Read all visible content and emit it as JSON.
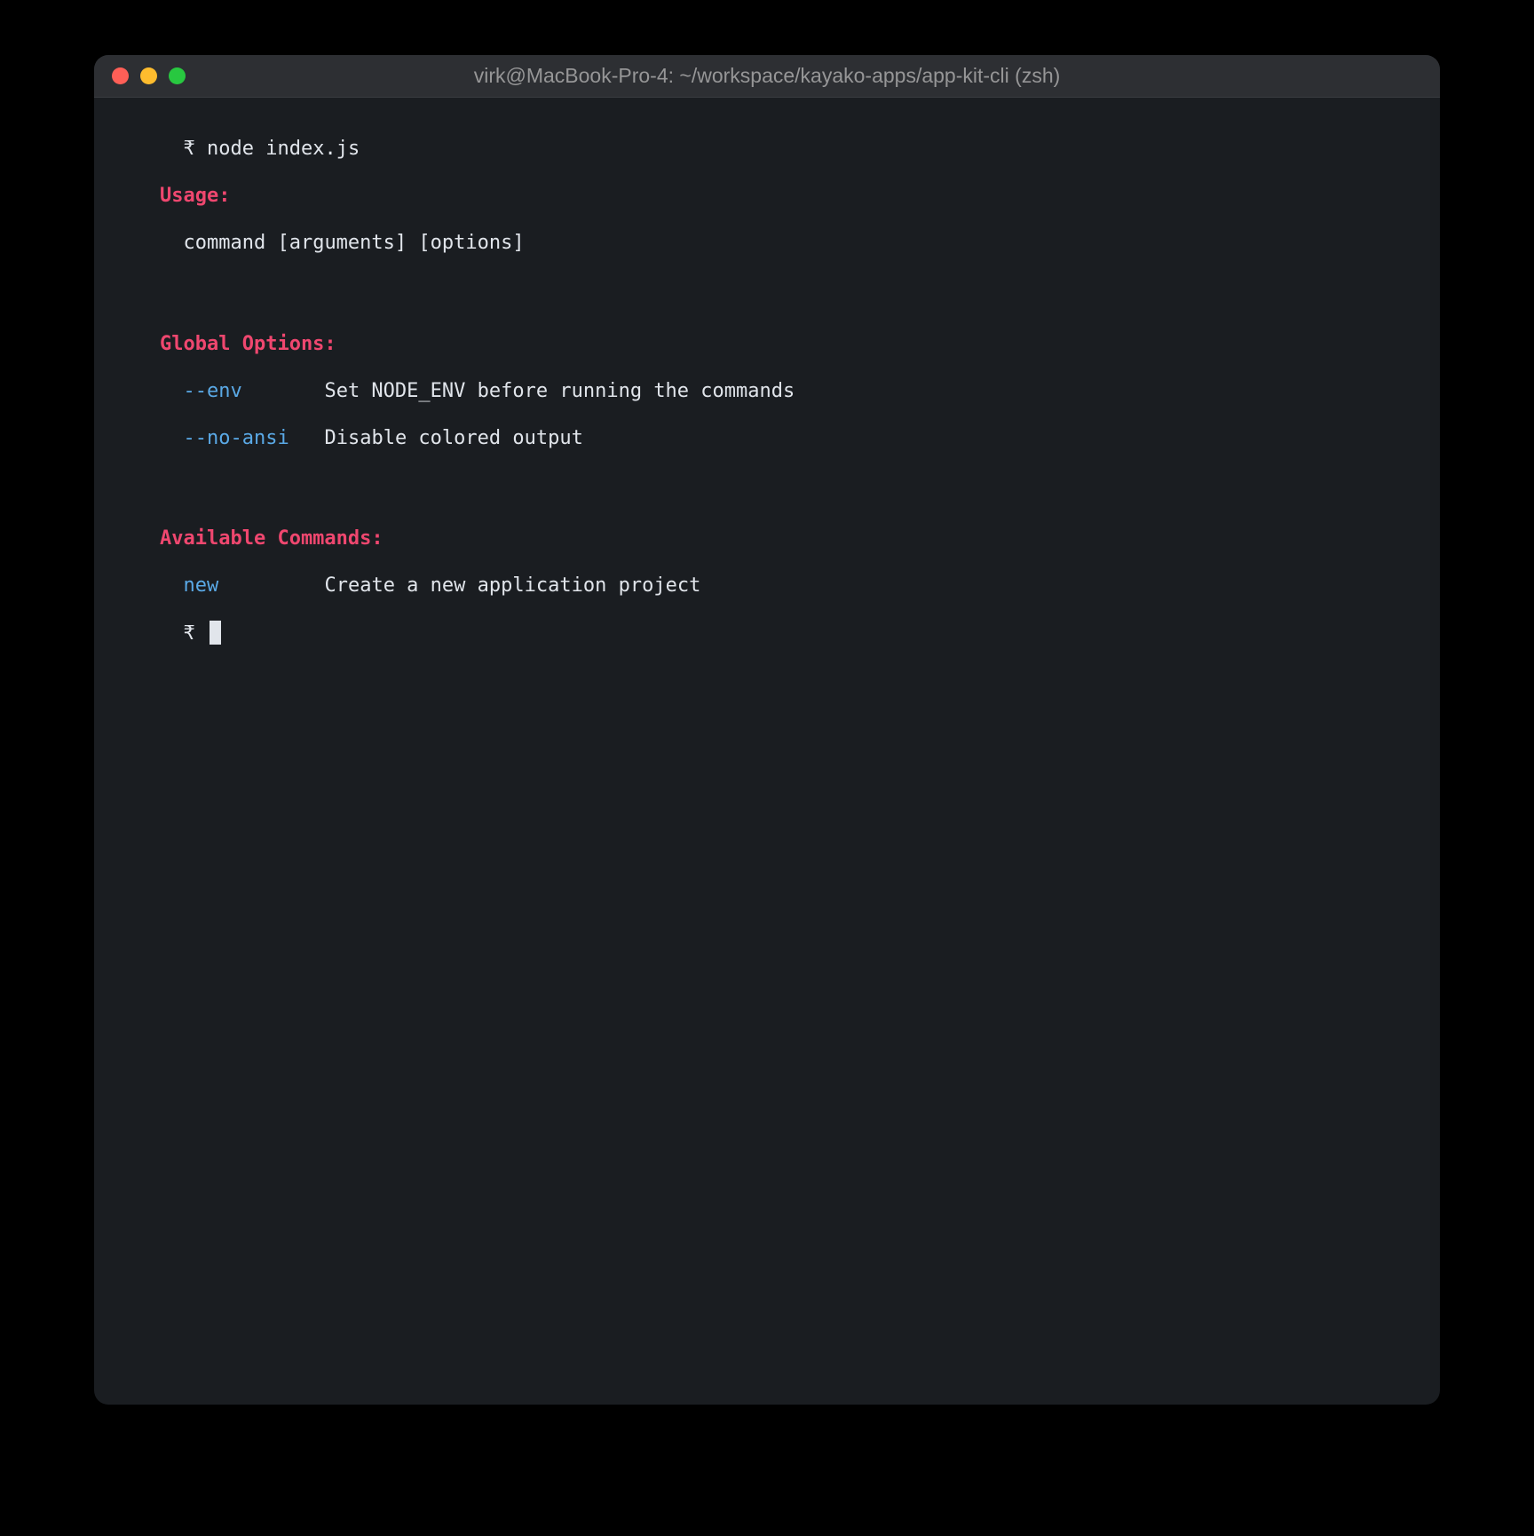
{
  "window": {
    "title": "virk@MacBook-Pro-4: ~/workspace/kayako-apps/app-kit-cli (zsh)"
  },
  "prompt": {
    "symbol": "₹",
    "command": "node index.js"
  },
  "sections": {
    "usage": {
      "header": "Usage:",
      "body": "command [arguments] [options]"
    },
    "global_options": {
      "header": "Global Options:",
      "items": [
        {
          "flag": "--env",
          "desc": "Set NODE_ENV before running the commands"
        },
        {
          "flag": "--no-ansi",
          "desc": "Disable colored output"
        }
      ]
    },
    "available_commands": {
      "header": "Available Commands:",
      "items": [
        {
          "name": "new",
          "desc": "Create a new application project"
        }
      ]
    }
  },
  "prompt_end": {
    "symbol": "₹"
  }
}
